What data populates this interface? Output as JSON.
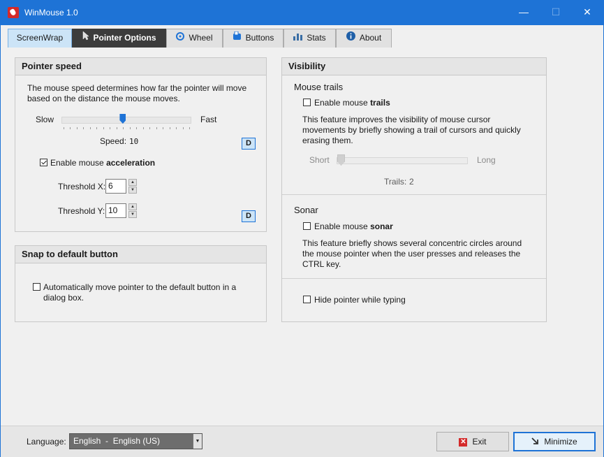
{
  "app": {
    "title": "WinMouse 1.0",
    "minimize_glyph": "—",
    "maximize_glyph": "☐",
    "close_glyph": "✕"
  },
  "tabs": [
    {
      "label": "ScreenWrap",
      "icon": ""
    },
    {
      "label": "Pointer Options",
      "icon": "pointer-icon"
    },
    {
      "label": "Wheel",
      "icon": "wheel-icon"
    },
    {
      "label": "Buttons",
      "icon": "buttons-icon"
    },
    {
      "label": "Stats",
      "icon": "stats-icon"
    },
    {
      "label": "About",
      "icon": "info-icon"
    }
  ],
  "pointer_speed": {
    "title": "Pointer speed",
    "description": "The mouse speed determines how far the pointer will move based on the distance the mouse moves.",
    "slow_label": "Slow",
    "fast_label": "Fast",
    "speed_label": "Speed:",
    "speed_value": "10",
    "speed_fraction": 0.47,
    "default_button": "D",
    "accel_label_prefix": "Enable mouse ",
    "accel_label_bold": "acceleration",
    "accel_checked": true,
    "threshold_x_label": "Threshold X:",
    "threshold_x_value": "6",
    "threshold_y_label": "Threshold Y:",
    "threshold_y_value": "10",
    "default_button_2": "D"
  },
  "snap": {
    "title": "Snap to default button",
    "checkbox_label": "Automatically move pointer to the default button in a dialog box.",
    "checked": false
  },
  "visibility": {
    "title": "Visibility",
    "trails_title": "Mouse trails",
    "trails_cb_prefix": "Enable mouse ",
    "trails_cb_bold": "trails",
    "trails_checked": false,
    "trails_description": "This feature improves the visibility of mouse cursor movements by briefly showing a trail of cursors and quickly erasing them.",
    "short_label": "Short",
    "long_label": "Long",
    "trails_label": "Trails:",
    "trails_value": "2",
    "trails_fraction": 0.0,
    "sonar_title": "Sonar",
    "sonar_cb_prefix": "Enable mouse ",
    "sonar_cb_bold": "sonar",
    "sonar_checked": false,
    "sonar_description": "This feature briefly shows several concentric circles around the mouse pointer when the user presses and releases the CTRL key.",
    "hide_label": "Hide pointer while typing",
    "hide_checked": false
  },
  "footer": {
    "language_label": "Language:",
    "language_value": "English  -  English (US)",
    "exit_label": "Exit",
    "minimize_label": "Minimize"
  },
  "colors": {
    "accent": "#1e73d6",
    "active_tab": "#3c3c3c",
    "exit_red": "#d42a2a"
  }
}
